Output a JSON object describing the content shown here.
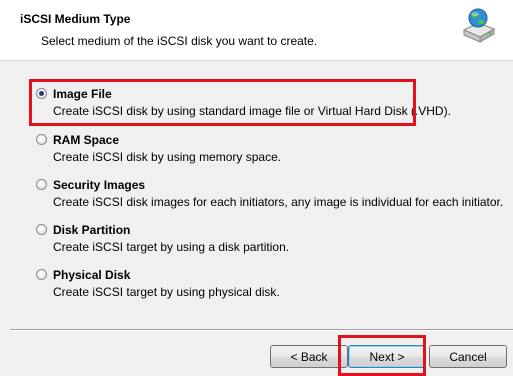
{
  "header": {
    "title": "iSCSI Medium Type",
    "subtitle": "Select medium of the iSCSI disk you want to create."
  },
  "options": [
    {
      "label": "Image File",
      "description": "Create iSCSI disk by using standard image file or Virtual Hard Disk (.VHD).",
      "selected": true
    },
    {
      "label": "RAM Space",
      "description": "Create iSCSI disk by using memory space.",
      "selected": false
    },
    {
      "label": "Security Images",
      "description": "Create iSCSI disk images for each initiators, any image is individual for each initiator.",
      "selected": false
    },
    {
      "label": "Disk Partition",
      "description": "Create iSCSI target by using a disk partition.",
      "selected": false
    },
    {
      "label": "Physical Disk",
      "description": "Create iSCSI target by using physical disk.",
      "selected": false
    }
  ],
  "buttons": {
    "back": "< Back",
    "next": "Next >",
    "cancel": "Cancel"
  },
  "colors": {
    "highlight": "#e4101c"
  }
}
